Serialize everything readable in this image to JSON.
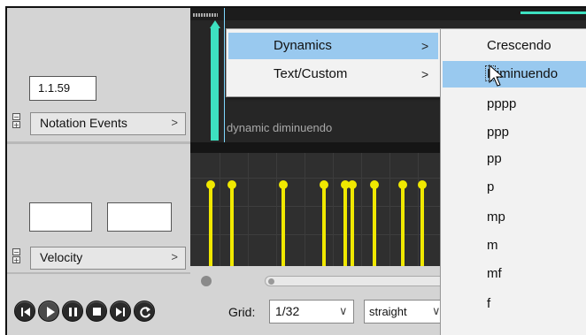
{
  "left_panel": {
    "position_value": "1.1.59",
    "notation_lane_label": "Notation Events",
    "velocity_lane_label": "Velocity",
    "value_box_1": "",
    "value_box_2": ""
  },
  "midi_editor": {
    "notation_event_text": "dynamic diminuendo",
    "grid_label": "Grid:",
    "grid_value": "1/32",
    "grid_type_value": "straight",
    "playhead_color": "#3de0c0",
    "velocity_color": "#f0e800",
    "velocity_levels": [
      1,
      1,
      1,
      1,
      1,
      1,
      1,
      1,
      1
    ]
  },
  "transport": {
    "buttons": [
      "skip-back-icon",
      "play-icon",
      "pause-icon",
      "stop-icon",
      "skip-forward-icon",
      "repeat-icon"
    ]
  },
  "context_menu": {
    "items": [
      {
        "label": "Dynamics",
        "submenu_arrow": ">"
      },
      {
        "label": "Text/Custom",
        "submenu_arrow": ">"
      }
    ]
  },
  "dynamics_submenu": {
    "items": [
      "Crescendo",
      "Diminuendo",
      "pppp",
      "ppp",
      "pp",
      "p",
      "mp",
      "m",
      "mf",
      "f"
    ],
    "highlighted": "Diminuendo",
    "highlight_color": "#99c9ef"
  }
}
